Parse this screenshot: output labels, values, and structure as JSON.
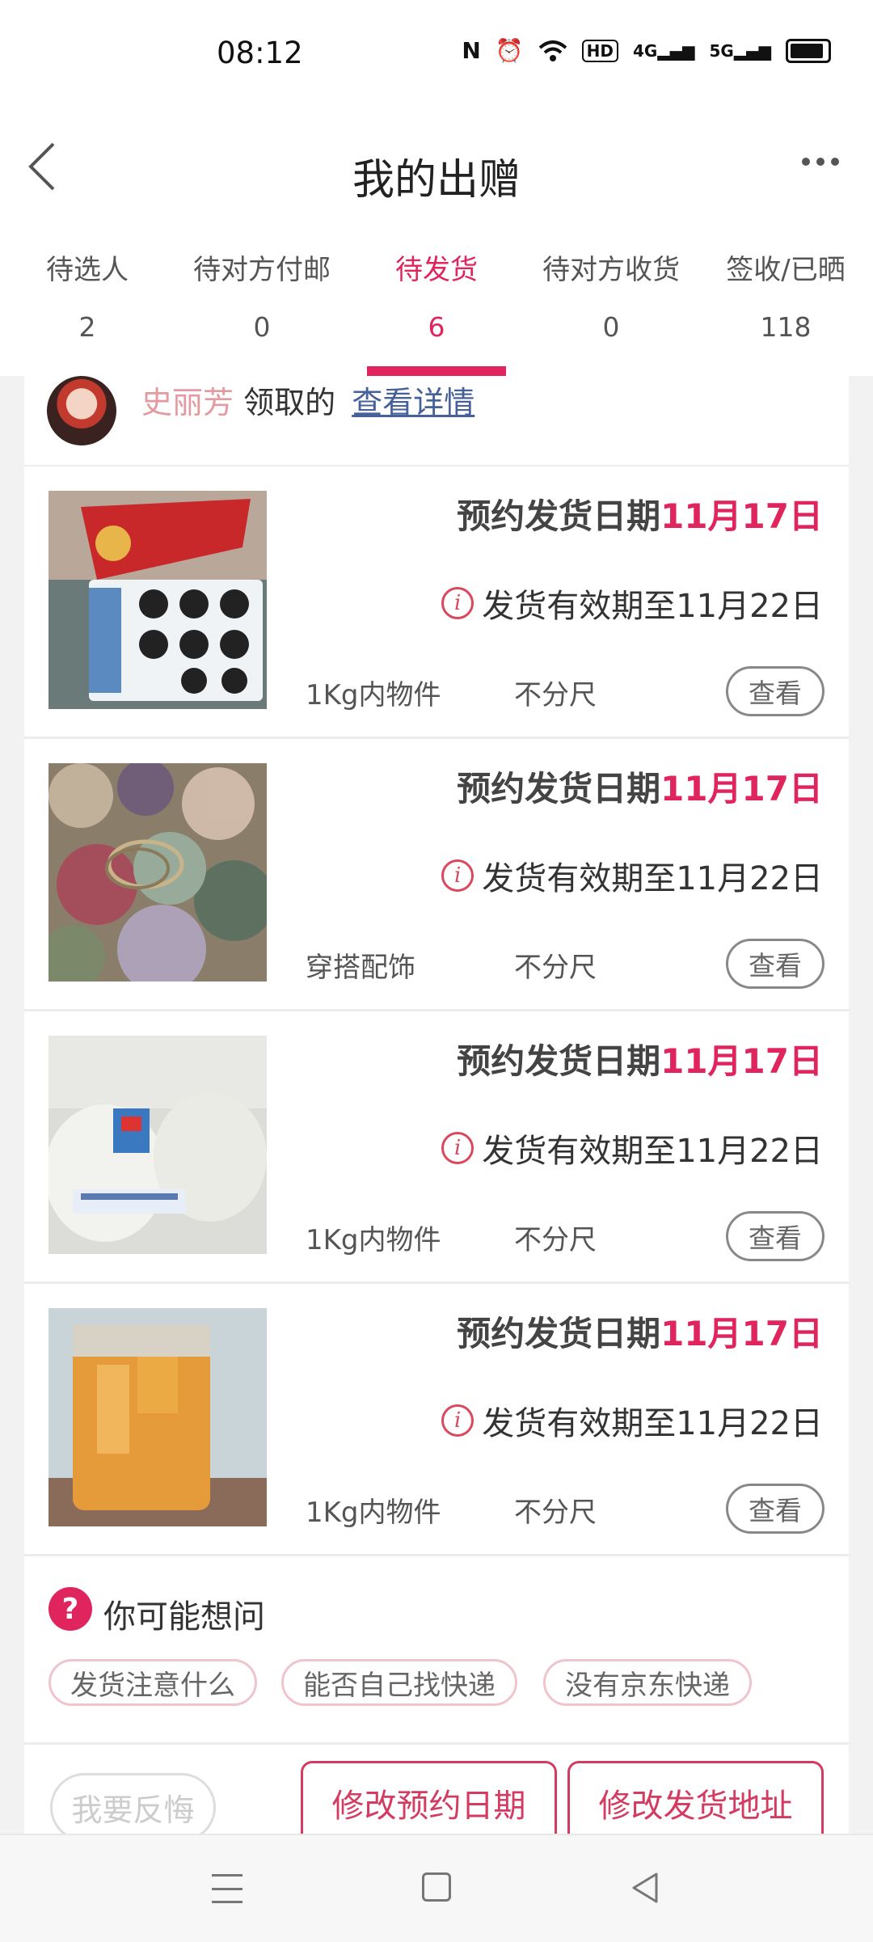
{
  "status_bar": {
    "time": "08:12",
    "hd_label": "HD",
    "signal1": "4G",
    "signal2": "5G"
  },
  "header": {
    "title": "我的出赠"
  },
  "tabs": [
    {
      "label": "待选人",
      "count": "2"
    },
    {
      "label": "待对方付邮",
      "count": "0"
    },
    {
      "label": "待发货",
      "count": "6",
      "active": true
    },
    {
      "label": "待对方收货",
      "count": "0"
    },
    {
      "label": "签收/已晒",
      "count": "118"
    }
  ],
  "claim": {
    "name": "史丽芳",
    "suffix": "领取的",
    "link": "查看详情"
  },
  "items": [
    {
      "date_prefix": "预约发货日期",
      "date": "11月17日",
      "valid": "发货有效期至11月22日",
      "category": "1Kg内物件",
      "size": "不分尺",
      "button": "查看"
    },
    {
      "date_prefix": "预约发货日期",
      "date": "11月17日",
      "valid": "发货有效期至11月22日",
      "category": "穿搭配饰",
      "size": "不分尺",
      "button": "查看"
    },
    {
      "date_prefix": "预约发货日期",
      "date": "11月17日",
      "valid": "发货有效期至11月22日",
      "category": "1Kg内物件",
      "size": "不分尺",
      "button": "查看"
    },
    {
      "date_prefix": "预约发货日期",
      "date": "11月17日",
      "valid": "发货有效期至11月22日",
      "category": "1Kg内物件",
      "size": "不分尺",
      "button": "查看"
    }
  ],
  "faq": {
    "title": "你可能想问",
    "chips": [
      "发货注意什么",
      "能否自己找快递",
      "没有京东快递"
    ]
  },
  "actions": {
    "regret": "我要反悔",
    "change_date": "修改预约日期",
    "change_address": "修改发货地址"
  },
  "colors": {
    "accent": "#e0245e",
    "link": "#46609a"
  },
  "icons": [
    "back-icon",
    "more-icon",
    "info-icon",
    "question-icon",
    "menu-icon",
    "home-icon",
    "back-nav-icon"
  ]
}
